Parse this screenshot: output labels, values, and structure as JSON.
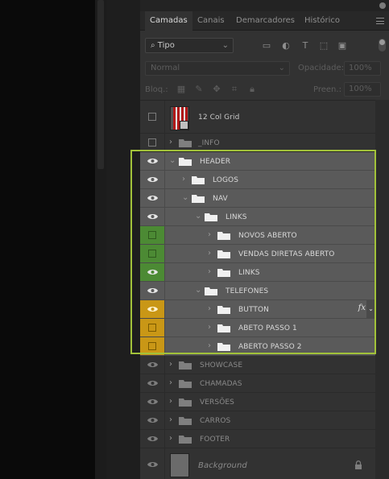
{
  "tabs": [
    {
      "label": "Camadas",
      "active": true
    },
    {
      "label": "Canais",
      "active": false
    },
    {
      "label": "Demarcadores",
      "active": false
    },
    {
      "label": "Histórico",
      "active": false
    }
  ],
  "filter": {
    "kind_label": "Tipo",
    "icons": [
      "image-filter-icon",
      "adjustment-filter-icon",
      "type-filter-icon",
      "shape-filter-icon",
      "smart-object-filter-icon"
    ]
  },
  "blend": {
    "mode": "Normal",
    "opacity_label": "Opacidade:",
    "opacity_value": "100%"
  },
  "lock": {
    "label": "Bloq.:",
    "fill_label": "Preen.:",
    "fill_value": "100%"
  },
  "layers": [
    {
      "name": "12 Col Grid",
      "kind": "smart-object",
      "visible": false
    },
    {
      "name": "_INFO",
      "kind": "group",
      "visible": false
    },
    {
      "name": "HEADER",
      "kind": "group",
      "visible": true,
      "expanded": true
    },
    {
      "name": "LOGOS",
      "kind": "group",
      "visible": true
    },
    {
      "name": "NAV",
      "kind": "group",
      "visible": true,
      "expanded": true
    },
    {
      "name": "LINKS",
      "kind": "group",
      "visible": true,
      "expanded": true
    },
    {
      "name": "NOVOS ABERTO",
      "kind": "group",
      "visible": false,
      "color": "green"
    },
    {
      "name": "VENDAS DIRETAS ABERTO",
      "kind": "group",
      "visible": false,
      "color": "green"
    },
    {
      "name": "LINKS",
      "kind": "group",
      "visible": true,
      "color": "green"
    },
    {
      "name": "TELEFONES",
      "kind": "group",
      "visible": true,
      "expanded": true
    },
    {
      "name": "BUTTON",
      "kind": "group",
      "visible": true,
      "color": "yellow",
      "fx": "fx"
    },
    {
      "name": "ABETO PASSO 1",
      "kind": "group",
      "visible": false,
      "color": "yellow"
    },
    {
      "name": "ABERTO PASSO 2",
      "kind": "group",
      "visible": false,
      "color": "yellow"
    },
    {
      "name": "SHOWCASE",
      "kind": "group",
      "visible": true
    },
    {
      "name": "CHAMADAS",
      "kind": "group",
      "visible": true
    },
    {
      "name": "VERSÕES",
      "kind": "group",
      "visible": true
    },
    {
      "name": "CARROS",
      "kind": "group",
      "visible": true
    },
    {
      "name": "FOOTER",
      "kind": "group",
      "visible": true
    },
    {
      "name": "Background",
      "kind": "background",
      "visible": true,
      "locked": true
    }
  ],
  "colors": {
    "selection_outline": "#a2c23a",
    "green_label": "#4c8a34",
    "yellow_label": "#c99716"
  }
}
